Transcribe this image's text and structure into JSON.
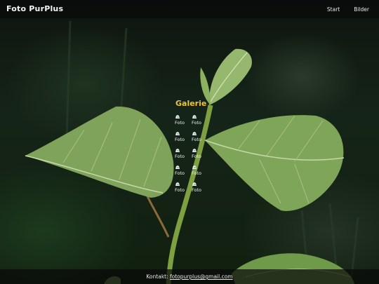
{
  "header": {
    "brand": "Foto PurPlus",
    "nav": [
      {
        "label": "Start"
      },
      {
        "label": "Bilder"
      }
    ]
  },
  "gallery": {
    "title": "Galerie",
    "items": [
      {
        "caption": "Foto",
        "icon": "broken-image-icon"
      },
      {
        "caption": "Foto",
        "icon": "broken-image-icon"
      },
      {
        "caption": "Foto",
        "icon": "broken-image-icon"
      },
      {
        "caption": "Foto",
        "icon": "broken-image-icon"
      },
      {
        "caption": "Foto",
        "icon": "broken-image-icon"
      },
      {
        "caption": "Foto",
        "icon": "broken-image-icon"
      },
      {
        "caption": "Foto",
        "icon": "broken-image-icon"
      },
      {
        "caption": "Foto",
        "icon": "broken-image-icon"
      },
      {
        "caption": "Foto",
        "icon": "broken-image-icon"
      },
      {
        "caption": "Foto",
        "icon": "broken-image-icon"
      }
    ]
  },
  "footer": {
    "label": "Kontakt:",
    "email": "fotopurplus@gmail.com"
  },
  "colors": {
    "accent": "#f1c232",
    "bar": "#0a0a0a",
    "text": "#f0f0f0"
  }
}
